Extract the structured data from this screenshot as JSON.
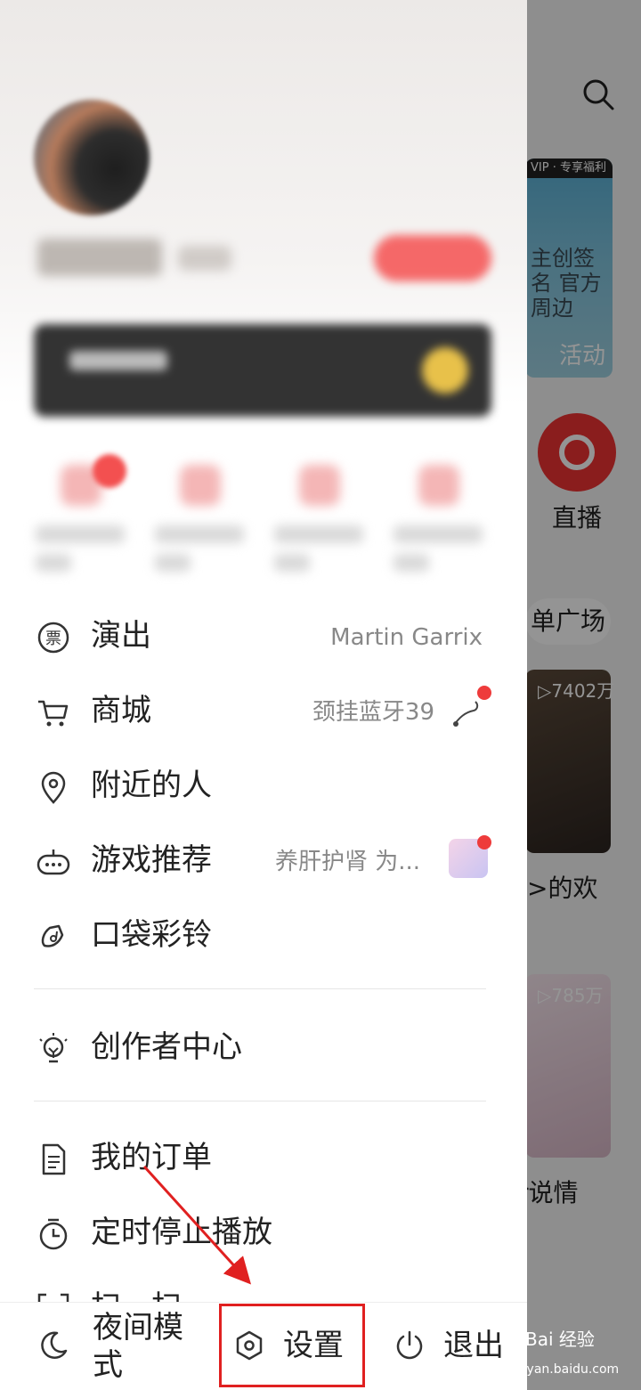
{
  "background_app": {
    "banner_tag": "VIP · 专享福利",
    "banner_poem": "主创签名 官方周边",
    "banner_action": "活动",
    "live_label": "直播",
    "square_label": "单广场",
    "card1_count": "▷7402万",
    "card1_text": ">的欢",
    "card2_count": "▷785万",
    "card2_text": "r说情"
  },
  "menu": [
    {
      "icon": "ticket-icon",
      "label": "演出",
      "right": "Martin Garrix"
    },
    {
      "icon": "cart-icon",
      "label": "商城",
      "right": "颈挂蓝牙39"
    },
    {
      "icon": "location-pin-icon",
      "label": "附近的人",
      "right": ""
    },
    {
      "icon": "gamepad-icon",
      "label": "游戏推荐",
      "right": "养肝护肾 为..."
    },
    {
      "icon": "bell-music-icon",
      "label": "口袋彩铃",
      "right": ""
    },
    {
      "icon": "lightbulb-icon",
      "label": "创作者中心",
      "right": ""
    },
    {
      "icon": "document-icon",
      "label": "我的订单",
      "right": ""
    },
    {
      "icon": "timer-icon",
      "label": "定时停止播放",
      "right": ""
    },
    {
      "icon": "scan-icon",
      "label": "扫一扫",
      "right": ""
    }
  ],
  "bottom_bar": {
    "night_mode_line1": "夜间模",
    "night_mode_line2": "式",
    "settings": "设置",
    "logout": "退出"
  },
  "watermark": {
    "brand": "Bai 经验",
    "url": "jingyan.baidu.com"
  },
  "colors": {
    "accent_red": "#e02020",
    "badge_red": "#ee3b3b"
  }
}
